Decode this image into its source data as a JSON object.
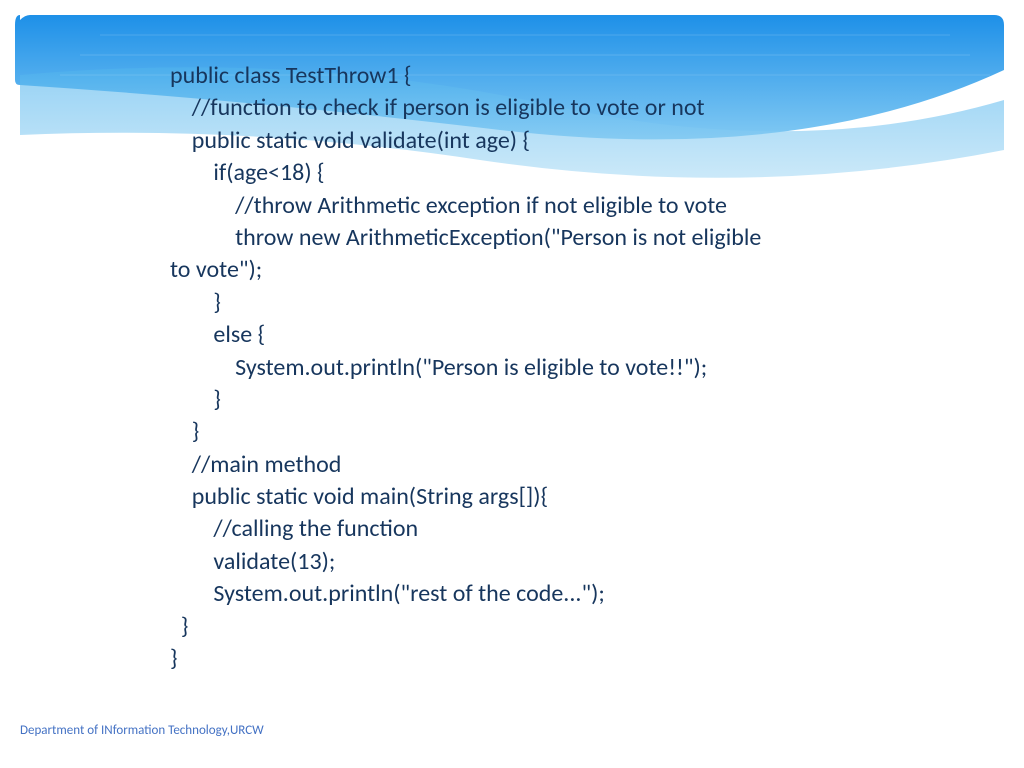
{
  "code": {
    "line1": "public class TestThrow1 {",
    "line2": "    //function to check if person is eligible to vote or not",
    "line3": "    public static void validate(int age) {",
    "line4": "        if(age<18) {",
    "line5": "            //throw Arithmetic exception if not eligible to vote",
    "line6": "            throw new ArithmeticException(\"Person is not eligible ",
    "line7": "to vote\");",
    "line8": "        }",
    "line9": "        else {",
    "line10": "            System.out.println(\"Person is eligible to vote!!\");",
    "line11": "        }",
    "line12": "    }",
    "line13": "    //main method",
    "line14": "    public static void main(String args[]){",
    "line15": "        //calling the function",
    "line16": "        validate(13);",
    "line17": "        System.out.println(\"rest of the code...\");",
    "line18": "  }",
    "line19": "}"
  },
  "footer": {
    "text": "Department of INformation Technology,URCW"
  }
}
